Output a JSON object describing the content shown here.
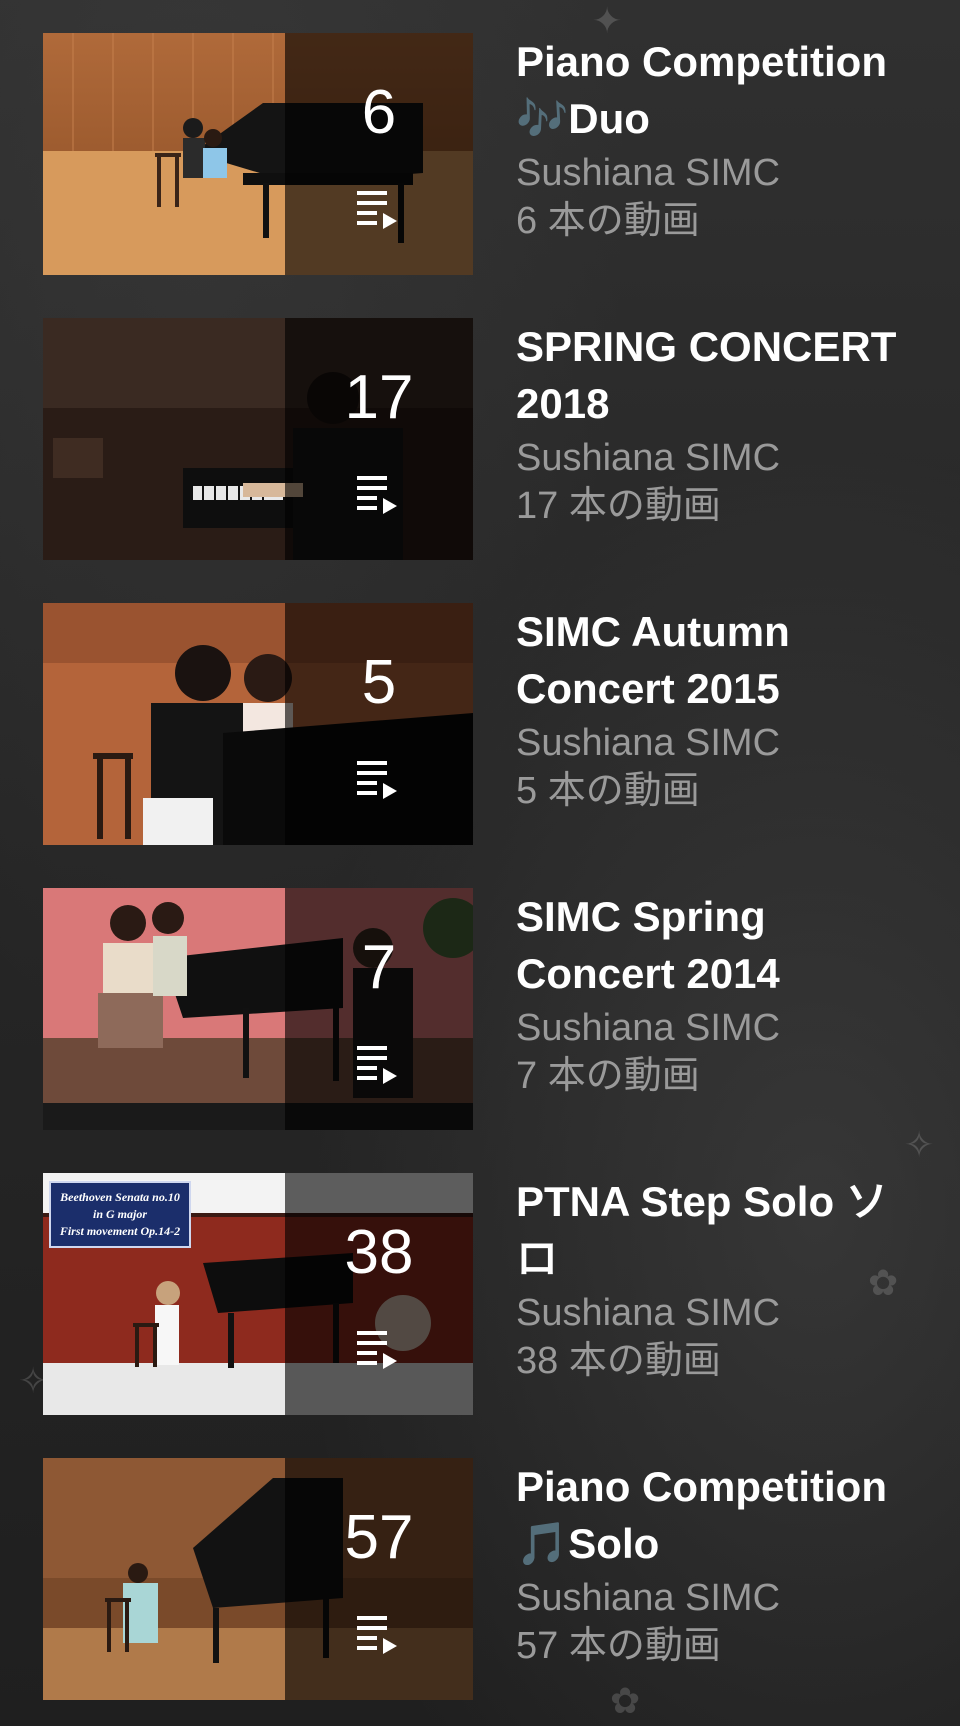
{
  "playlists": [
    {
      "title": "Piano Competition 🎶Duo",
      "title_main": "Piano Competition",
      "title_note": "🎶",
      "title_suffix": "Duo",
      "count": "6",
      "channel": "Sushiana SIMC",
      "videos": "6 本の動画",
      "thumbnail_icon": "queue-icon"
    },
    {
      "title": "SPRING CONCERT 2018",
      "count": "17",
      "channel": "Sushiana SIMC",
      "videos": "17 本の動画",
      "thumbnail_icon": "queue-icon"
    },
    {
      "title": "SIMC Autumn Concert 2015",
      "count": "5",
      "channel": "Sushiana SIMC",
      "videos": "5 本の動画",
      "thumbnail_icon": "queue-icon"
    },
    {
      "title": "SIMC Spring Concert 2014",
      "count": "7",
      "channel": "Sushiana SIMC",
      "videos": "7 本の動画",
      "thumbnail_icon": "queue-icon"
    },
    {
      "title": "PTNA Step Solo ソロ",
      "count": "38",
      "channel": "Sushiana SIMC",
      "videos": "38 本の動画",
      "thumbnail_icon": "queue-icon",
      "thumbnail_caption": [
        "Beethoven Senata no.10",
        "in G major",
        "First movement Op.14-2"
      ]
    },
    {
      "title": "Piano Competition 🎵Solo",
      "title_main": "Piano Competition",
      "title_note": "🎵",
      "title_suffix": "Solo",
      "count": "57",
      "channel": "Sushiana SIMC",
      "videos": "57 本の動画",
      "thumbnail_icon": "queue-icon"
    }
  ],
  "colors": {
    "background": "#282828",
    "title": "#ffffff",
    "meta": "#9a9a9a",
    "note_accent": "#e31b1b",
    "overlay": "rgba(0,0,0,0.62)"
  }
}
